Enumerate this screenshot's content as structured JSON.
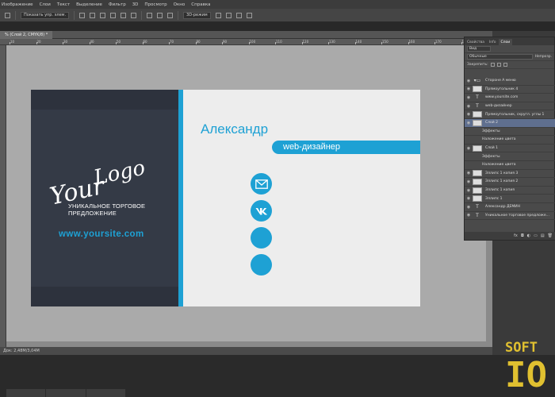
{
  "menu": [
    "Изображение",
    "Слои",
    "Текст",
    "Выделение",
    "Фильтр",
    "3D",
    "Просмотр",
    "Окно",
    "Справка"
  ],
  "options": {
    "auto_select": "Показать упр. элем.",
    "mode_3d": "3D-режим"
  },
  "document": {
    "tab_title": "% (Слой 2, CMYK/8) *",
    "status": "Док: 2,48M/3,04M"
  },
  "ruler_ticks": [
    "10",
    "20",
    "30",
    "40",
    "50",
    "60",
    "70",
    "80",
    "90",
    "100",
    "110",
    "120",
    "130",
    "140",
    "150",
    "160",
    "170",
    "180"
  ],
  "card": {
    "logo_line1": "Logo",
    "logo_line2": "Your",
    "tagline_1": "УНИКАЛЬНОЕ ТОРГОВОЕ",
    "tagline_2": "ПРЕДЛОЖЕНИЕ",
    "website": "www.yoursite.com",
    "name": "Александр",
    "role": "web-дизайнер",
    "accent": "#1ea1d4",
    "dark": "#343a46",
    "icons": [
      "mail-icon",
      "vk-icon",
      "blank-circle-icon",
      "blank-circle-icon"
    ]
  },
  "layers_panel": {
    "tabs": [
      "Свойства",
      "Info",
      "Слои"
    ],
    "kind_filter": "Вид",
    "blend_mode": "Обычные",
    "opacity_label": "Непрозр.",
    "lock_label": "Закрепить:",
    "layers": [
      {
        "name": "Стороне A меню",
        "type": "group"
      },
      {
        "name": "Прямоугольник 4",
        "type": "shape"
      },
      {
        "name": "www.yoursite.com",
        "type": "text"
      },
      {
        "name": "web-дизайнер",
        "type": "text"
      },
      {
        "name": "Прямоугольник, скругл. углы 1",
        "type": "shape"
      },
      {
        "name": "Слой 2",
        "type": "shape",
        "selected": true
      },
      {
        "name": "Эффекты",
        "type": "fx"
      },
      {
        "name": "Наложение цвета",
        "type": "fx"
      },
      {
        "name": "Слой 1",
        "type": "shape"
      },
      {
        "name": "Эффекты",
        "type": "fx"
      },
      {
        "name": "Наложение цвета",
        "type": "fx"
      },
      {
        "name": "Эллипс 1 копия 3",
        "type": "shape"
      },
      {
        "name": "Эллипс 1 копия 2",
        "type": "shape"
      },
      {
        "name": "Эллипс 1 копия",
        "type": "shape"
      },
      {
        "name": "Эллипс 1",
        "type": "shape"
      },
      {
        "name": "Александр ДЕМИН",
        "type": "text"
      },
      {
        "name": "Уникальное торговое предложе...",
        "type": "text"
      }
    ],
    "footer": [
      "fx",
      "◘",
      "◐",
      "▭",
      "▤",
      "🗑"
    ]
  },
  "watermark": {
    "line1": "SOFT",
    "line2": "IO",
    "color": "#e0c030"
  }
}
